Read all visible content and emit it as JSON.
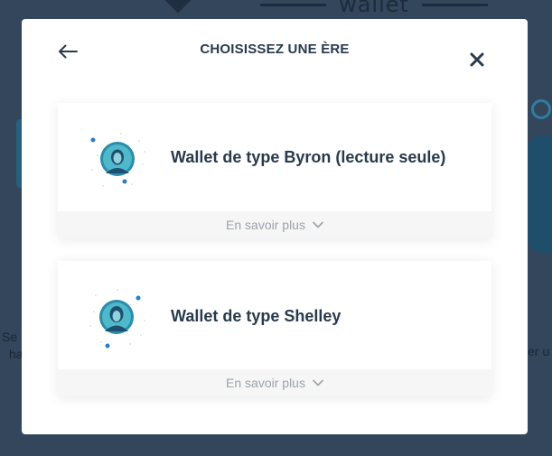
{
  "background": {
    "wordmark": "wallet",
    "text_left": [
      "Se",
      "ha"
    ],
    "text_right": "er u"
  },
  "modal": {
    "title": "CHOISISSEZ UNE ÈRE",
    "back_icon": "arrow-left-icon",
    "close_icon": "close-icon"
  },
  "eras": [
    {
      "name": "Wallet de type Byron (lecture seule)",
      "portrait_icon": "byron-portrait-icon",
      "learn_more": "En savoir plus",
      "learn_more_icon": "chevron-down-icon"
    },
    {
      "name": "Wallet de type Shelley",
      "portrait_icon": "shelley-portrait-icon",
      "learn_more": "En savoir plus",
      "learn_more_icon": "chevron-down-icon"
    }
  ],
  "colors": {
    "title_text": "#283a4c",
    "muted_text": "#9aa2ab",
    "portrait_ring": "#2a8cab",
    "overlay": "#33465b"
  }
}
